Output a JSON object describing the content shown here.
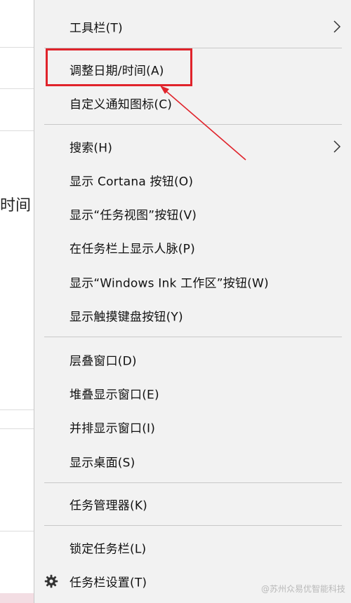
{
  "background_window": {
    "partial_text": "时间"
  },
  "menu": {
    "items": [
      {
        "label": "工具栏(T)",
        "has_submenu": true
      },
      {
        "label": "调整日期/时间(A)",
        "highlighted": true
      },
      {
        "label": "自定义通知图标(C)"
      },
      {
        "label": "搜索(H)",
        "has_submenu": true
      },
      {
        "label": "显示 Cortana 按钮(O)"
      },
      {
        "label": "显示“任务视图”按钮(V)"
      },
      {
        "label": "在任务栏上显示人脉(P)"
      },
      {
        "label": "显示“Windows Ink 工作区”按钮(W)"
      },
      {
        "label": "显示触摸键盘按钮(Y)"
      },
      {
        "label": "层叠窗口(D)"
      },
      {
        "label": "堆叠显示窗口(E)"
      },
      {
        "label": "并排显示窗口(I)"
      },
      {
        "label": "显示桌面(S)"
      },
      {
        "label": "任务管理器(K)"
      },
      {
        "label": "锁定任务栏(L)"
      },
      {
        "label": "任务栏设置(T)",
        "icon": "gear-icon"
      }
    ]
  },
  "annotation": {
    "color": "#e0232b"
  },
  "watermark": {
    "text": "@苏州众易优智能科技"
  }
}
